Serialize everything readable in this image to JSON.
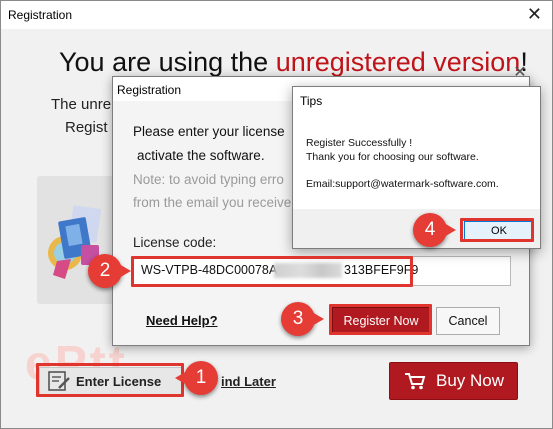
{
  "main_window": {
    "title": "Registration",
    "close_glyph": "✕",
    "headline_prefix": "You are using the ",
    "headline_emphasis": "unregistered version",
    "headline_suffix": "!",
    "subtext_line1": "The unre",
    "subtext_line2": "Regist",
    "behind_close_glyph": "✕",
    "watermark_text": "ePtt",
    "enter_license_label": "Enter License",
    "remind_later_label": "ind Later",
    "buy_now_label": "Buy Now"
  },
  "registration_dialog": {
    "title": "Registration",
    "instruction_line1": "Please enter your license",
    "instruction_line2": "activate the software.",
    "note_line1": "Note: to avoid typing erro",
    "note_line2": "from the email you receive",
    "license_label": "License code:",
    "license_value_start": "WS-VTPB-48DC00078A",
    "license_value_end": "313BFEF9F9",
    "need_help_label": "Need Help?",
    "register_button_label": "Register Now",
    "cancel_button_label": "Cancel"
  },
  "tips_dialog": {
    "title": "Tips",
    "message_line1": "Register Successfully !",
    "message_line2": "Thank you for choosing our software.",
    "message_line3": "Email:support@watermark-software.com.",
    "ok_button_label": "OK"
  },
  "annotations": {
    "step1": "1",
    "step2": "2",
    "step3": "3",
    "step4": "4",
    "highlight_color": "#e0352f"
  },
  "colors": {
    "accent_red": "#b0191f",
    "headline_red": "#c0141a"
  },
  "icons": [
    "edit-license-icon",
    "cart-icon",
    "product-icon",
    "close-icon"
  ]
}
